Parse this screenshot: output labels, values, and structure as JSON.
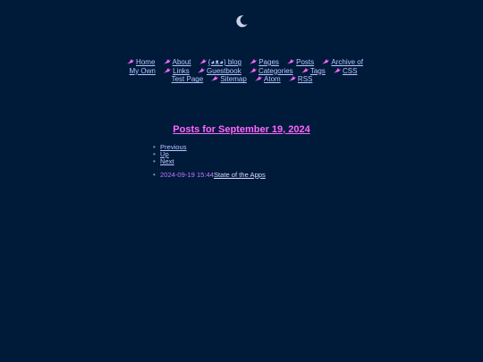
{
  "header": {
    "icon": "crescent-moon-icon"
  },
  "nav": {
    "items": [
      {
        "label": "Home"
      },
      {
        "label": "About"
      },
      {
        "label": "(◕ᴥ◕) blog"
      },
      {
        "label": "Pages"
      },
      {
        "label": "Posts"
      },
      {
        "label": "Archive of My Own"
      },
      {
        "label": "Links"
      },
      {
        "label": "Guestbook"
      },
      {
        "label": "Categories"
      },
      {
        "label": "Tags"
      },
      {
        "label": "CSS Test Page"
      },
      {
        "label": "Sitemap"
      },
      {
        "label": "Atom"
      },
      {
        "label": "RSS"
      }
    ],
    "icon": "bird-icon",
    "accent": "#ff66ff"
  },
  "main": {
    "title": "Posts for September 19, 2024",
    "links": {
      "previous": "Previous",
      "up": "Up",
      "next": "Next"
    },
    "posts": [
      {
        "time": "2024-09-19 15:44",
        "title": "State of the Apps"
      }
    ]
  },
  "colors": {
    "background": "#001a3a",
    "link": "#b9c6ff",
    "title": "#ff66ff",
    "timestamp": "#c276ff"
  }
}
